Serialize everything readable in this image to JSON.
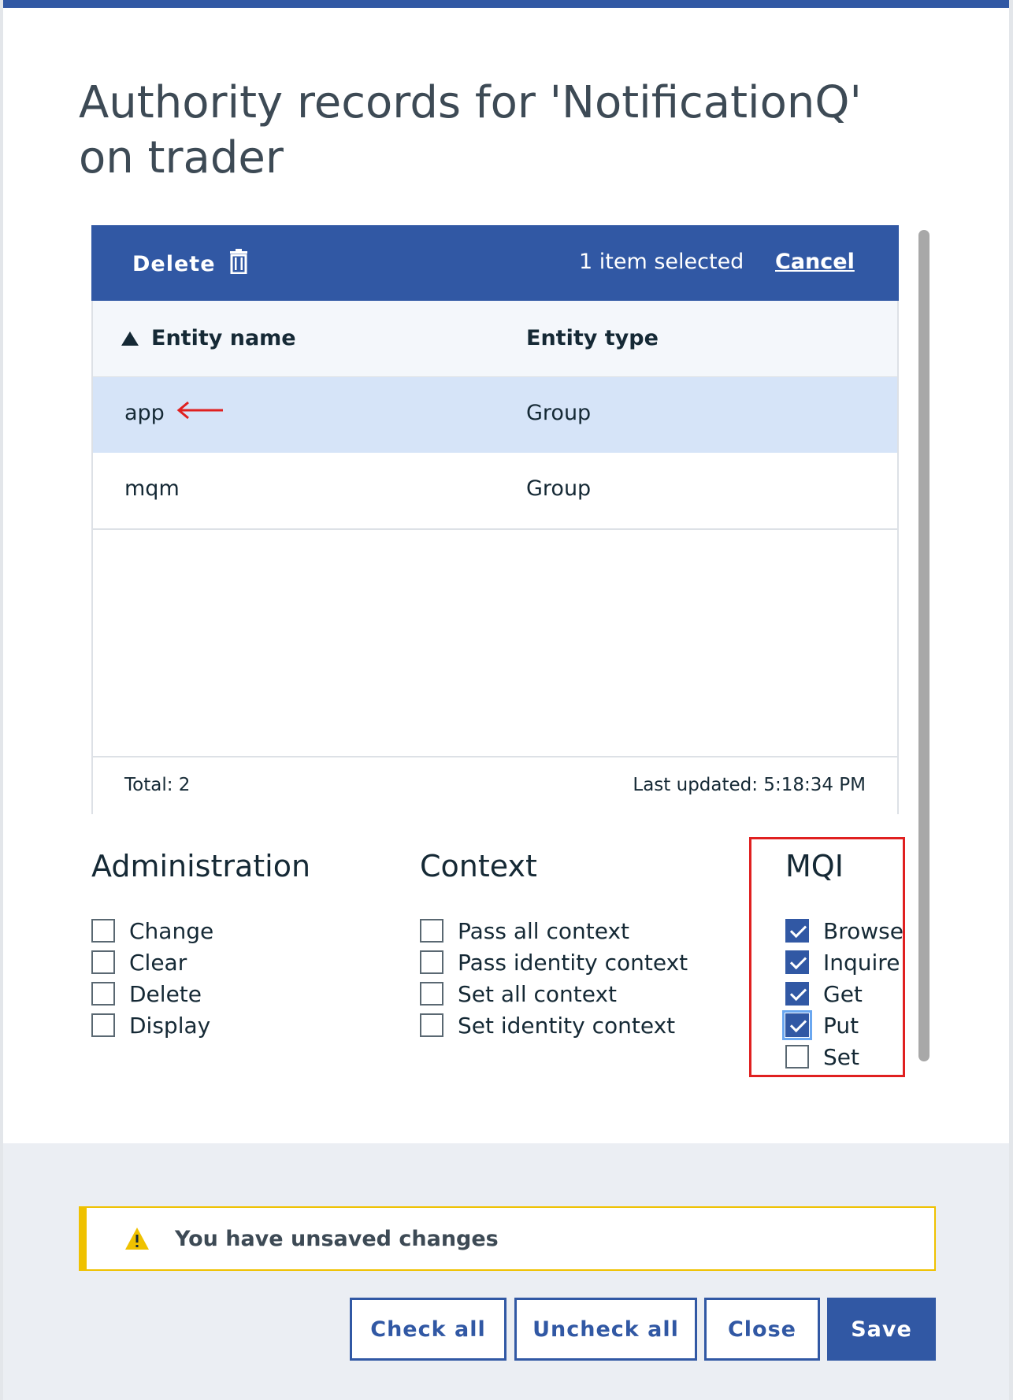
{
  "dialog": {
    "title": "Authority records for 'NotificationQ' on trader"
  },
  "table": {
    "batch_bar": {
      "delete_label": "Delete",
      "selected_text": "1 item selected",
      "cancel_label": "Cancel"
    },
    "columns": {
      "name": "Entity name",
      "type": "Entity type",
      "sort_direction": "ascending"
    },
    "rows": [
      {
        "name": "app",
        "type": "Group",
        "selected": true
      },
      {
        "name": "mqm",
        "type": "Group",
        "selected": false
      }
    ],
    "footer": {
      "total": "Total: 2",
      "last_updated": "Last updated: 5:18:34 PM"
    }
  },
  "permissions": {
    "administration": {
      "title": "Administration",
      "items": [
        {
          "label": "Change",
          "checked": false
        },
        {
          "label": "Clear",
          "checked": false
        },
        {
          "label": "Delete",
          "checked": false
        },
        {
          "label": "Display",
          "checked": false
        }
      ]
    },
    "context": {
      "title": "Context",
      "items": [
        {
          "label": "Pass all context",
          "checked": false
        },
        {
          "label": "Pass identity context",
          "checked": false
        },
        {
          "label": "Set all context",
          "checked": false
        },
        {
          "label": "Set identity context",
          "checked": false
        }
      ]
    },
    "mqi": {
      "title": "MQI",
      "items": [
        {
          "label": "Browse",
          "checked": true
        },
        {
          "label": "Inquire",
          "checked": true
        },
        {
          "label": "Get",
          "checked": true
        },
        {
          "label": "Put",
          "checked": true,
          "focused": true
        },
        {
          "label": "Set",
          "checked": false
        }
      ]
    }
  },
  "notification": {
    "text": "You have unsaved changes",
    "icon": "warning-icon"
  },
  "buttons": {
    "check_all": "Check all",
    "uncheck_all": "Uncheck all",
    "close": "Close",
    "save": "Save"
  },
  "colors": {
    "primary": "#3158a4",
    "selected_row": "#d6e4f8",
    "warning": "#efc100",
    "annotation": "#e02020"
  }
}
